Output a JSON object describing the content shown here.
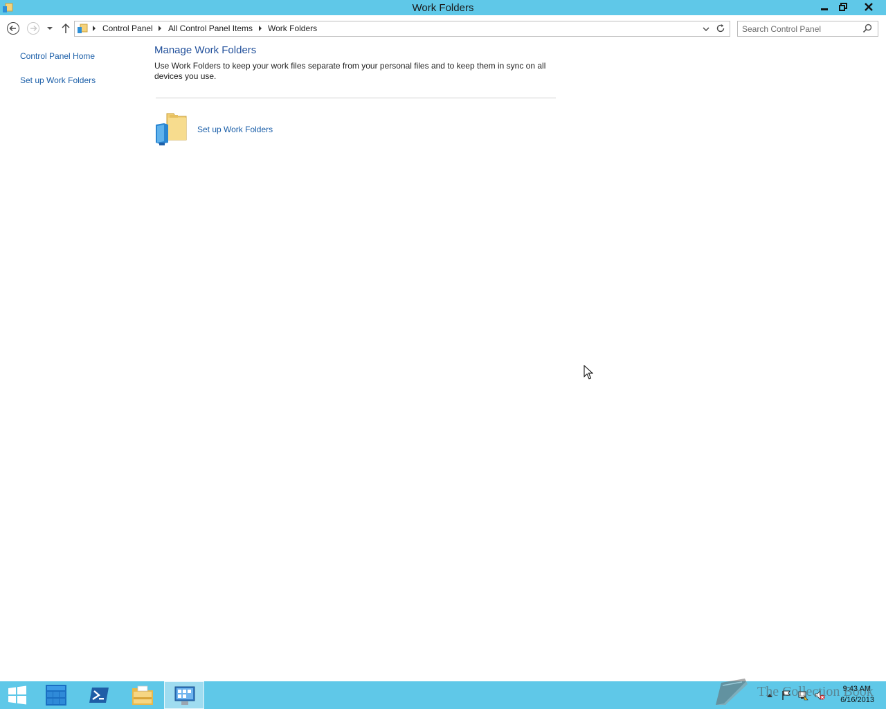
{
  "window": {
    "title": "Work Folders"
  },
  "navigation": {
    "breadcrumbs": [
      "Control Panel",
      "All Control Panel Items",
      "Work Folders"
    ],
    "search_placeholder": "Search Control Panel"
  },
  "left_pane": {
    "links": [
      "Control Panel Home",
      "Set up Work Folders"
    ]
  },
  "main": {
    "heading": "Manage Work Folders",
    "description": "Use Work Folders to keep your work files separate from your personal files and to keep them in sync on all devices you use.",
    "task_link": "Set up Work Folders",
    "task_icon": "work-folders-icon"
  },
  "taskbar": {
    "items": [
      "start-icon",
      "server-manager-icon",
      "powershell-icon",
      "file-explorer-icon",
      "control-panel-icon"
    ],
    "active_item": "control-panel-icon",
    "tray_icons": [
      "show-hidden-icons-arrow",
      "flag-icon",
      "network-icon",
      "speaker-muted-icon"
    ],
    "clock_time": "9:43 AM",
    "clock_date": "6/16/2013"
  },
  "watermark": {
    "text": "The Collection Book"
  },
  "colors": {
    "title_bar": "#5fc8e8",
    "taskbar": "#5fc8e8",
    "link": "#1a5ea8",
    "heading": "#1f4e9a"
  }
}
